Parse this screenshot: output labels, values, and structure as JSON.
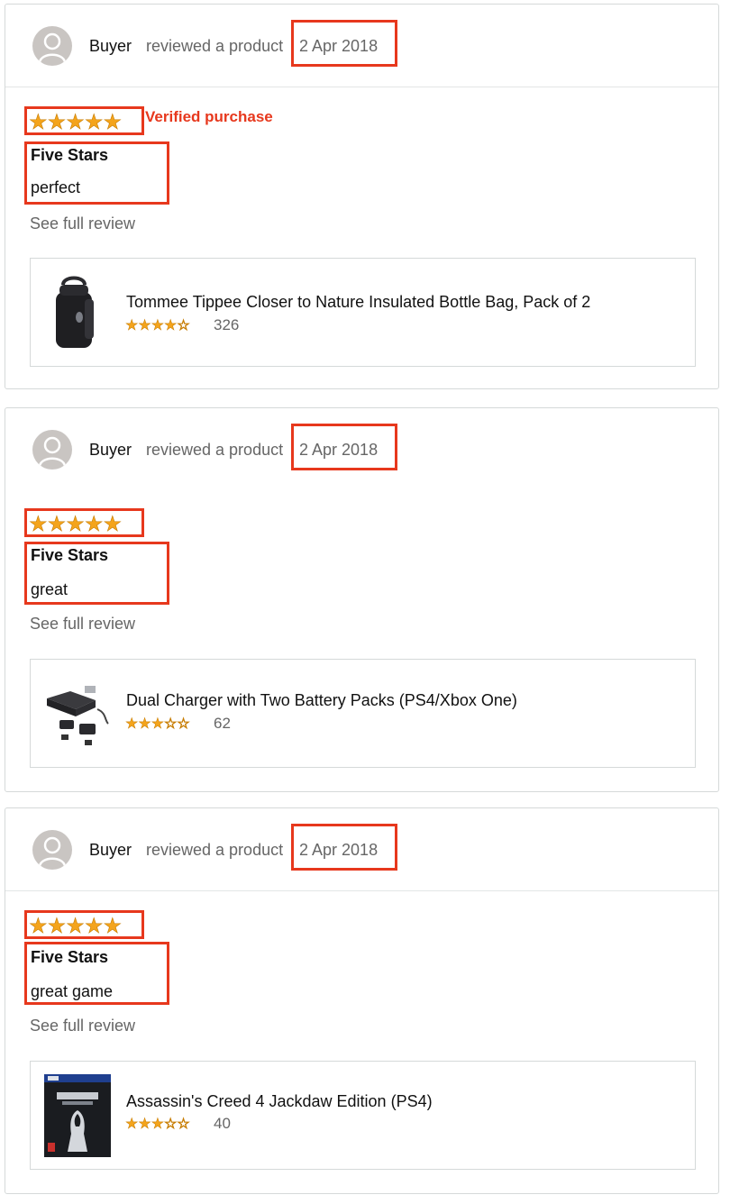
{
  "reviews": [
    {
      "reviewer": "Buyer",
      "action": "reviewed a product",
      "date": "2 Apr 2018",
      "stars": "★★★★★",
      "verified": "Verified purchase",
      "title": "Five Stars",
      "body": "perfect",
      "see_full": "See full review",
      "product": {
        "name": "Tommee Tippee Closer to Nature Insulated Bottle Bag, Pack of 2",
        "rating": 4,
        "stars_filled": "★★★★",
        "stars_empty": "☆",
        "rating_count": "326",
        "thumb_icon": "insulated-bottle-bag"
      }
    },
    {
      "reviewer": "Buyer",
      "action": "reviewed a product",
      "date": "2 Apr 2018",
      "stars": "★★★★★",
      "title": "Five Stars",
      "body": "great",
      "see_full": "See full review",
      "product": {
        "name": "Dual Charger with Two Battery Packs (PS4/Xbox One)",
        "rating": 3.5,
        "stars_filled": "★★★",
        "stars_empty": "☆☆",
        "rating_count": "62",
        "thumb_icon": "dual-charger"
      }
    },
    {
      "reviewer": "Buyer",
      "action": "reviewed a product",
      "date": "2 Apr 2018",
      "stars": "★★★★★",
      "title": "Five Stars",
      "body": "great game",
      "see_full": "See full review",
      "product": {
        "name": "Assassin's Creed 4 Jackdaw Edition (PS4)",
        "rating": 3.5,
        "stars_filled": "★★★",
        "stars_empty": "☆☆",
        "rating_count": "40",
        "thumb_icon": "game-cover"
      }
    }
  ],
  "colors": {
    "highlight": "#e7381d",
    "star": "#f4a41c",
    "muted_text": "#666666"
  }
}
